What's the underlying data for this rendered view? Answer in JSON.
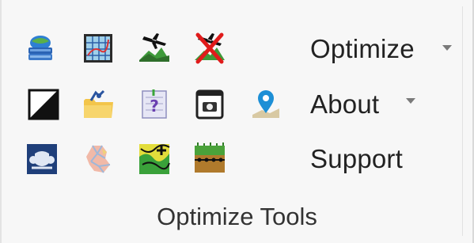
{
  "group": {
    "label": "Optimize Tools"
  },
  "commands": {
    "optimize": {
      "label": "Optimize",
      "has_dropdown": true
    },
    "about": {
      "label": "About",
      "has_dropdown": true
    },
    "support": {
      "label": "Support",
      "has_dropdown": false
    }
  },
  "icons": [
    "database-globe-icon",
    "grid-map-icon",
    "terrain-aircraft-icon",
    "remove-aircraft-icon",
    "black-white-square-icon",
    "folder-tool-icon",
    "question-document-icon",
    "camera-window-icon",
    "location-pin-icon",
    "coat-of-arms-icon",
    "province-map-icon",
    "topographic-map-icon",
    "soil-layer-icon"
  ],
  "colors": {
    "ribbon_background": "#f7f7f7",
    "text": "#222222",
    "dropdown_caret": "#7a7a7a"
  }
}
